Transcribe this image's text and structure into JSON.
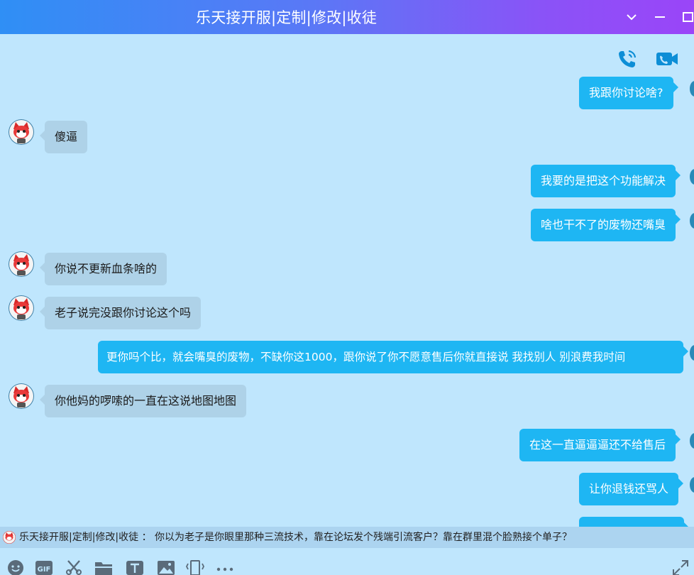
{
  "window": {
    "title": "乐天接开服|定制|修改|收徒",
    "controls": [
      "chevron-down-icon",
      "minimize-icon",
      "maximize-icon"
    ]
  },
  "call_actions": [
    "voice-call-icon",
    "video-call-icon"
  ],
  "messages": [
    {
      "side": "right",
      "text": "我跟你讨论啥?"
    },
    {
      "side": "left",
      "text": "傻逼"
    },
    {
      "side": "right",
      "text": "我要的是把这个功能解决"
    },
    {
      "side": "right",
      "text": "啥也干不了的废物还嘴臭"
    },
    {
      "side": "left",
      "text": "你说不更新血条啥的"
    },
    {
      "side": "left",
      "text": "老子说完没跟你讨论这个吗"
    },
    {
      "side": "right",
      "text": "更你吗个比，就会嘴臭的废物，不缺你这1000，跟你说了你不愿意售后你就直接说 我找别人 别浪费我时间"
    },
    {
      "side": "left",
      "text": "你他妈的啰嗦的一直在这说地图地图"
    },
    {
      "side": "right",
      "text": "在这一直逼逼逼还不给售后"
    },
    {
      "side": "right",
      "text": "让你退钱还骂人"
    }
  ],
  "status_bar": {
    "text": "乐天接开服|定制|修改|收徒 ： 你以为老子是你眼里那种三流技术，靠在论坛发个残端引流客户？靠在群里混个脸熟接个单子？"
  },
  "toolbar": {
    "tools": [
      "emoji-icon",
      "gif-icon",
      "scissors-icon",
      "folder-icon",
      "text-icon",
      "image-icon",
      "shake-icon",
      "more-icon"
    ],
    "expand": "expand-icon"
  },
  "colors": {
    "background": "#bfe6fd",
    "incoming_bubble": "#aed2e8",
    "outgoing_bubble": "#1eb6f3",
    "accent_icon": "#0d8ed6"
  }
}
